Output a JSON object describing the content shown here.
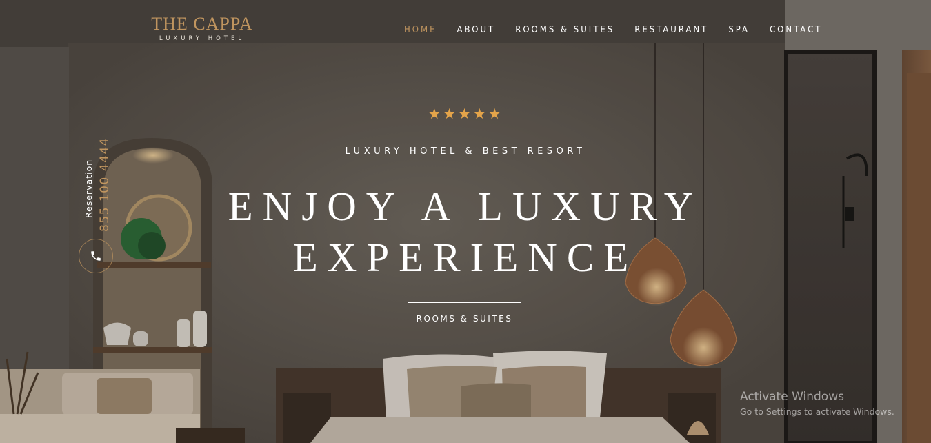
{
  "brand": {
    "title": "THE CAPPA",
    "subtitle": "LUXURY HOTEL",
    "accent_color": "#c0955f"
  },
  "nav": {
    "items": [
      {
        "label": "HOME",
        "active": true
      },
      {
        "label": "ABOUT",
        "active": false
      },
      {
        "label": "ROOMS & SUITES",
        "active": false
      },
      {
        "label": "RESTAURANT",
        "active": false
      },
      {
        "label": "SPA",
        "active": false
      },
      {
        "label": "CONTACT",
        "active": false
      }
    ]
  },
  "hero": {
    "stars": "★★★★★",
    "star_count": 5,
    "star_color": "#e4a44a",
    "kicker": "LUXURY HOTEL & BEST RESORT",
    "headline_line1": "ENJOY A LUXURY",
    "headline_line2": "EXPERIENCE",
    "cta_label": "ROOMS & SUITES"
  },
  "reservation": {
    "label": "Reservation",
    "phone": "855 100 4444",
    "icon": "phone-icon"
  },
  "watermark": {
    "title": "Activate Windows",
    "subtitle": "Go to Settings to activate Windows."
  }
}
